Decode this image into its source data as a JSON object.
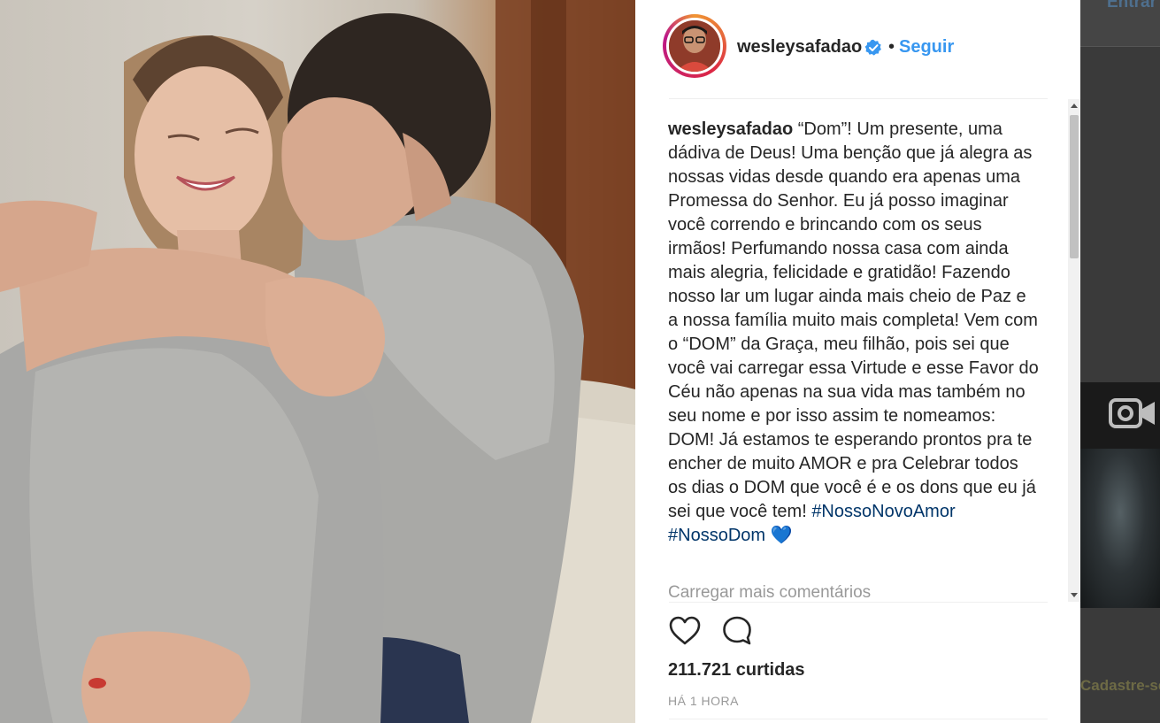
{
  "post": {
    "username": "wesleysafadao",
    "separator": "•",
    "follow_label": "Seguir",
    "caption": {
      "username": "wesleysafadao",
      "text": " “Dom”! Um presente, uma dádiva de Deus! Uma benção que já alegra as nossas vidas desde quando era apenas uma Promessa do Senhor. Eu já posso imaginar você correndo e brincando com os seus irmãos! Perfumando nossa casa com ainda mais alegria, felicidade e gratidão! Fazendo nosso lar um lugar ainda mais cheio de Paz e a nossa família muito mais completa! Vem com o “DOM” da Graça, meu filhão, pois sei que você vai carregar essa Virtude e esse Favor do Céu não apenas na sua vida mas também no seu nome e por isso assim te nomeamos: DOM! Já estamos te esperando prontos pra te encher de muito AMOR e pra Celebrar todos os dias o DOM que você é e os dons que eu já sei que você tem! ",
      "hashtag1": "#NossoNovoAmor",
      "hashtag2": "#NossoDom",
      "emoji": "💙"
    },
    "load_more_label": "Carregar mais comentários",
    "likes_text": "211.721 curtidas",
    "time_text": "HÁ 1 HORA"
  },
  "icons": {
    "verified": "verified-badge-icon",
    "like": "heart-outline-icon",
    "comment": "speech-bubble-icon",
    "camera": "video-camera-icon"
  },
  "colors": {
    "link_blue": "#3897f0",
    "hashtag": "#003569",
    "text": "#262626",
    "muted": "#999999"
  },
  "background_page": {
    "header_link": "Entrar",
    "footer_text": "Cadastre-se"
  }
}
